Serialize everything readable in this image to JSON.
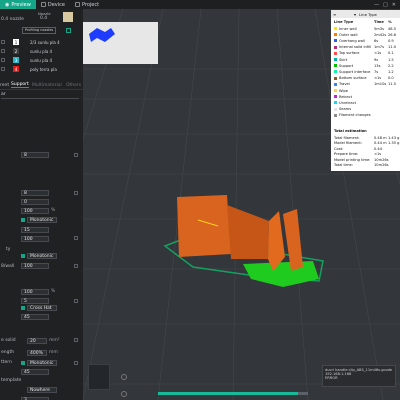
{
  "tabs": [
    {
      "label": "Preview",
      "active": true,
      "icon": "eye-icon"
    },
    {
      "label": "Device",
      "active": false,
      "icon": "device-icon"
    },
    {
      "label": "Project",
      "active": false,
      "icon": "project-icon"
    }
  ],
  "sidebar": {
    "printer_name": "0.4 nozzle",
    "nozzle_label": "Nozzle",
    "nozzle_value": "0.4",
    "profile_chip": "Profiling nozzles",
    "filaments": [
      {
        "num": "1",
        "name": "2/3 sunlu pla 4",
        "color": "#ffffff"
      },
      {
        "num": "2",
        "name": "sunlu pla 4",
        "color": "#3b3b3b"
      },
      {
        "num": "3",
        "name": "sunlu pla 4",
        "color": "#29b6c8"
      },
      {
        "num": "4",
        "name": "poly terra pla",
        "color": "#e21a1a"
      }
    ],
    "section_tabs": [
      "rent",
      "Support",
      "Multimaterial",
      "Others"
    ],
    "search_placeholder": "ar",
    "fields": [
      {
        "label": "",
        "value": "8"
      },
      {
        "label": "",
        "value": "8"
      },
      {
        "label": "",
        "value": "0"
      },
      {
        "label": "",
        "value": "100",
        "unit": "%"
      },
      {
        "label": "",
        "value": "Monotonic"
      },
      {
        "label": "",
        "value": "15"
      },
      {
        "label": "ty",
        "value": "100"
      },
      {
        "label": "",
        "value": "Monotonic"
      },
      {
        "label": "8/wall",
        "value": "100"
      },
      {
        "label": "",
        "value": "100",
        "unit": "%"
      },
      {
        "label": "",
        "value": "5"
      },
      {
        "label": "",
        "value": "Cross Hat"
      },
      {
        "label": "",
        "value": "45"
      },
      {
        "label": "e solid",
        "value": "20",
        "unit": "mm²"
      },
      {
        "label": "ength",
        "value": "400%",
        "unit": "mm"
      },
      {
        "label": "ttern",
        "value": "Monotonic"
      },
      {
        "label": "",
        "value": "45"
      },
      {
        "label": "template",
        "value": "Nowhere"
      },
      {
        "label": "",
        "value": "3"
      }
    ]
  },
  "legend": {
    "title": "Line Type",
    "col1": "Time",
    "col2": "%",
    "rows": [
      {
        "name": "Inner wall",
        "t": "5m3s",
        "p": "48.5",
        "color": "#ffe11a"
      },
      {
        "name": "Outer wall",
        "t": "2m42s",
        "p": "26.6",
        "color": "#ff7b00"
      },
      {
        "name": "Overhang wall",
        "t": "6s",
        "p": "0.9",
        "color": "#2e59ff"
      },
      {
        "name": "Internal solid infill",
        "t": "1m7s",
        "p": "11.0",
        "color": "#b02d7c"
      },
      {
        "name": "Top surface",
        "t": "<1s",
        "p": "0.1",
        "color": "#ff4d4d"
      },
      {
        "name": "Skirt",
        "t": "9s",
        "p": "1.5",
        "color": "#00b0a0"
      },
      {
        "name": "Support",
        "t": "13s",
        "p": "2.2",
        "color": "#00c400"
      },
      {
        "name": "Support interface",
        "t": "7s",
        "p": "1.2",
        "color": "#12f2a0"
      },
      {
        "name": "Bottom surface",
        "t": "<1s",
        "p": "0.0",
        "color": "#8a5a2b"
      },
      {
        "name": "Travel",
        "t": "1m10s",
        "p": "11.5",
        "color": "#3b82f6"
      },
      {
        "name": "Wipe",
        "t": "",
        "p": "",
        "color": "#fcd34d"
      },
      {
        "name": "Retract",
        "t": "",
        "p": "",
        "color": "#c026d3"
      },
      {
        "name": "Unretract",
        "t": "",
        "p": "",
        "color": "#22d3ee"
      },
      {
        "name": "Seams",
        "t": "",
        "p": "",
        "color": "#e5e5e5"
      },
      {
        "name": "Filament changes",
        "t": "",
        "p": "",
        "color": "#8b8b8b"
      }
    ],
    "estimation_title": "Total estimation",
    "estimation": [
      {
        "k": "Total filament:",
        "v1": "0.48 m",
        "v2": "1.43 g"
      },
      {
        "k": "Model filament:",
        "v1": "0.44 m",
        "v2": "1.35 g"
      },
      {
        "k": "Cost:",
        "v1": "0.44",
        "v2": ""
      },
      {
        "k": "Prepare time:",
        "v1": "<1s",
        "v2": ""
      },
      {
        "k": "Model printing time:",
        "v1": "10m26s",
        "v2": ""
      },
      {
        "k": "Total time:",
        "v1": "10m26s",
        "v2": ""
      }
    ]
  },
  "toast": {
    "line1": "ducri handle clip_ABS_11m46s.gcode",
    "line2": "192.168.1.168",
    "line3": "ERROR"
  },
  "colors": {
    "accent": "#17a589",
    "model_orange": "#d9641f",
    "support_green": "#1fcb1f"
  }
}
